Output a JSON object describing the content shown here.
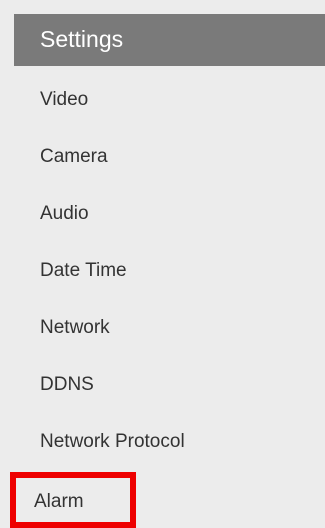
{
  "header": {
    "title": "Settings"
  },
  "menu": {
    "items": [
      {
        "label": "Video"
      },
      {
        "label": "Camera"
      },
      {
        "label": "Audio"
      },
      {
        "label": "Date Time"
      },
      {
        "label": "Network"
      },
      {
        "label": "DDNS"
      },
      {
        "label": "Network Protocol"
      },
      {
        "label": "Alarm",
        "highlighted": true
      }
    ]
  },
  "colors": {
    "header_bg": "#7a7a7a",
    "sidebar_bg": "#ececec",
    "highlight_border": "#ee0000",
    "text": "#333333"
  }
}
